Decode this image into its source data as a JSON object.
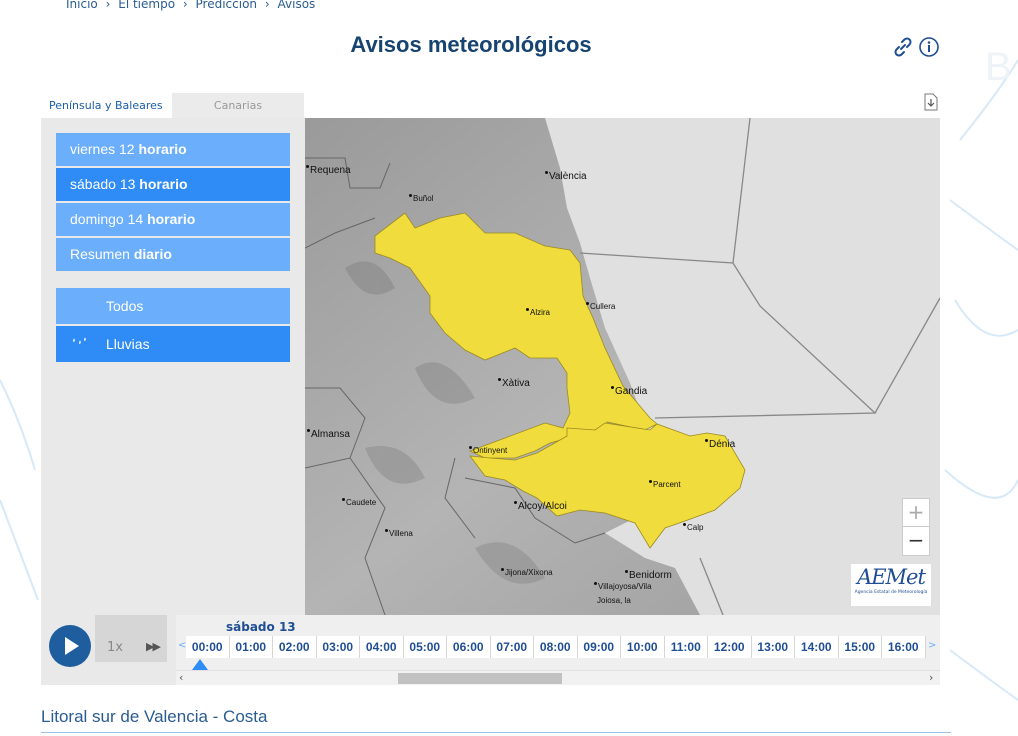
{
  "breadcrumb": [
    "Inicio",
    "›",
    "El tiempo",
    "›",
    "Predicción",
    "›",
    "Avisos"
  ],
  "title": "Avisos meteorológicos",
  "tabs": {
    "peninsula": "Península y Baleares",
    "canarias": "Canarias"
  },
  "days": [
    {
      "day": "viernes 12",
      "mode": "horario"
    },
    {
      "day": "sábado 13",
      "mode": "horario"
    },
    {
      "day": "domingo 14",
      "mode": "horario"
    },
    {
      "day": "Resumen",
      "mode": "diario"
    }
  ],
  "categories": {
    "todos": "Todos",
    "lluvias": "Lluvias"
  },
  "map": {
    "cities": {
      "requena": "Requena",
      "valencia": "València",
      "bunol": "Buñol",
      "alzira": "Alzira",
      "cullera": "Cullera",
      "xativa": "Xàtiva",
      "gandia": "Gandia",
      "almansa": "Almansa",
      "ontinyent": "Ontinyent",
      "denia": "Dénia",
      "parcent": "Parcent",
      "caudete": "Caudete",
      "alcoy": "Alcoy/Alcoi",
      "villena": "Villena",
      "calp": "Calp",
      "jijona": "Jijona/Xixona",
      "benidorm": "Benidorm",
      "villajoyosa_1": "Villajoyosa/Vila",
      "villajoyosa_2": "Joiosa, la"
    },
    "warning_color": "#f0dc3c",
    "logo": {
      "text": "AEMet",
      "subtitle": "Agencia Estatal de Meteorología"
    }
  },
  "player": {
    "speed": "1x"
  },
  "timeline": {
    "day": "sábado 13",
    "hours": [
      "00:00",
      "01:00",
      "02:00",
      "03:00",
      "04:00",
      "05:00",
      "06:00",
      "07:00",
      "08:00",
      "09:00",
      "10:00",
      "11:00",
      "12:00",
      "13:00",
      "14:00",
      "15:00",
      "16:00"
    ]
  },
  "region": "Litoral sur de Valencia - Costa",
  "colors": {
    "accent_light": "#6aaefc",
    "accent_dark": "#2f8cf7",
    "title": "#16436f"
  }
}
